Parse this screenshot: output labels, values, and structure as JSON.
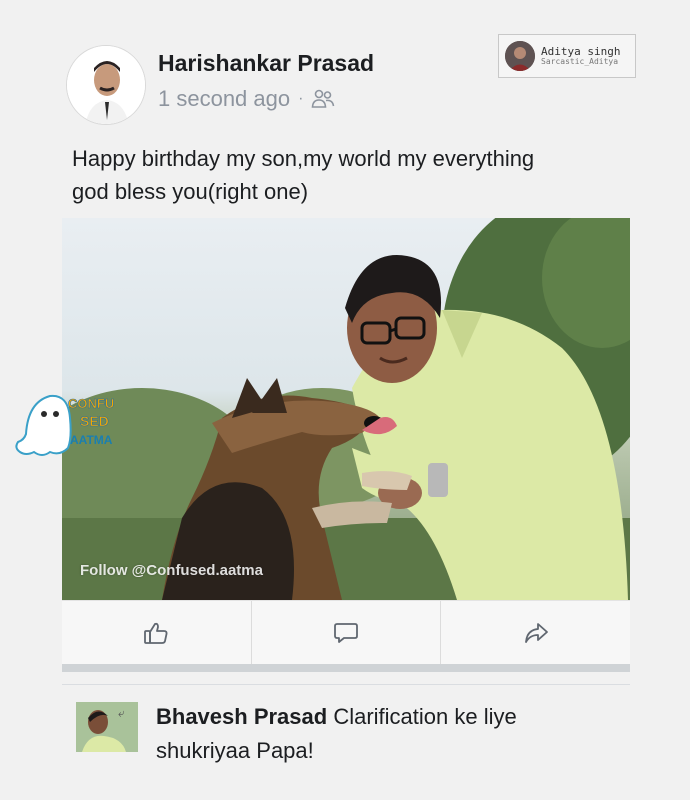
{
  "post": {
    "author": "Harishankar Prasad",
    "timestamp": "1 second ago",
    "separator": "·",
    "audience_icon": "friends-icon",
    "caption_line1": "Happy birthday my son,my world my everything",
    "caption_line2": "god bless you(right one)"
  },
  "badge": {
    "name": "Aditya singh",
    "handle": "Sarcastic_Aditya"
  },
  "photo": {
    "watermark": "Follow @Confused.aatma",
    "logo_lines": [
      "CONFU",
      "SED",
      "AATMA"
    ]
  },
  "actions": [
    {
      "icon": "like-icon"
    },
    {
      "icon": "comment-icon"
    },
    {
      "icon": "share-icon"
    }
  ],
  "comment": {
    "author": "Bhavesh Prasad",
    "text_part1": "Clarification ke liye",
    "text_part2": "shukriyaa Papa!"
  },
  "colors": {
    "meta_gray": "#8d949e",
    "shirt": "#dce9a6",
    "accent": "#1877f2"
  }
}
